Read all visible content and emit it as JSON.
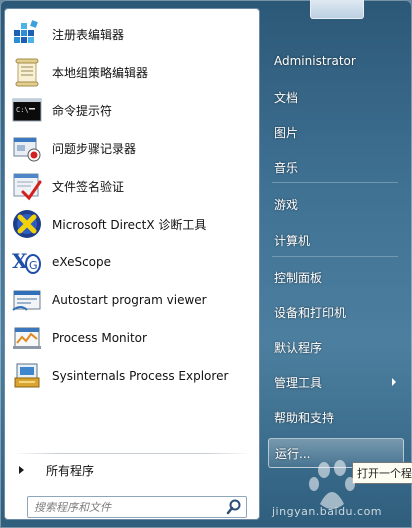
{
  "programs": [
    {
      "label": "注册表编辑器",
      "icon": "registry-editor-icon"
    },
    {
      "label": "本地组策略编辑器",
      "icon": "group-policy-editor-icon"
    },
    {
      "label": "命令提示符",
      "icon": "command-prompt-icon"
    },
    {
      "label": "问题步骤记录器",
      "icon": "steps-recorder-icon"
    },
    {
      "label": "文件签名验证",
      "icon": "file-signature-icon"
    },
    {
      "label": "Microsoft DirectX 诊断工具",
      "icon": "directx-icon"
    },
    {
      "label": "eXeScope",
      "icon": "exescope-icon"
    },
    {
      "label": "Autostart program viewer",
      "icon": "autostart-viewer-icon"
    },
    {
      "label": "Process Monitor",
      "icon": "process-monitor-icon"
    },
    {
      "label": "Sysinternals Process Explorer",
      "icon": "process-explorer-icon"
    }
  ],
  "all_programs_label": "所有程序",
  "search": {
    "placeholder": "搜索程序和文件"
  },
  "right_items": [
    {
      "label": "Administrator"
    },
    {
      "label": "文档"
    },
    {
      "label": "图片"
    },
    {
      "label": "音乐"
    },
    {
      "label": "游戏"
    },
    {
      "label": "计算机"
    },
    {
      "label": "控制面板"
    },
    {
      "label": "设备和打印机"
    },
    {
      "label": "默认程序"
    },
    {
      "label": "管理工具"
    },
    {
      "label": "帮助和支持"
    },
    {
      "label": "运行..."
    }
  ],
  "tooltip_text": "打开一个程",
  "watermark_text": "jingyan.baidu.com",
  "colors": {
    "menu_accent": "#3f7193",
    "left_pane_bg": "#ffffff",
    "tooltip_bg": "#fdfdf2"
  }
}
